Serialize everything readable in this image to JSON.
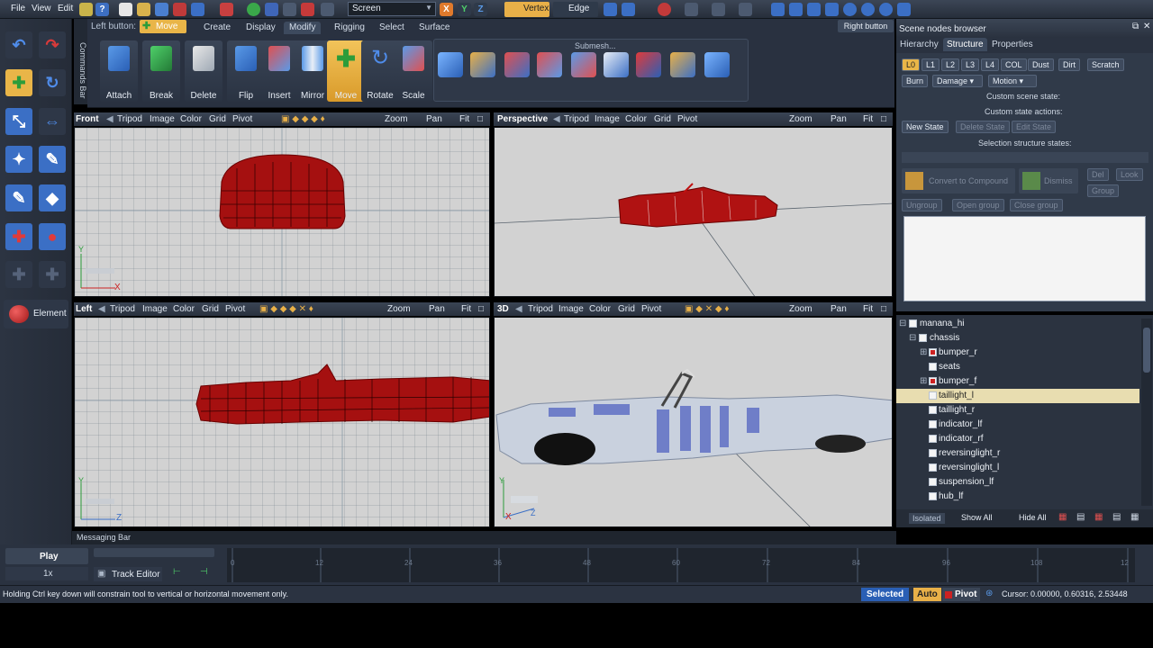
{
  "menu": {
    "file": "File",
    "view": "View",
    "edit": "Edit"
  },
  "toolbar": {
    "coord_mode": "Screen",
    "vertex": "Vertex",
    "edge": "Edge",
    "right_button": "Right button"
  },
  "commands": {
    "left_button_label": "Left button:",
    "left_button_tool": "Move",
    "side_label": "Commands Bar",
    "tabs": [
      "Create",
      "Display",
      "Modify",
      "Rigging",
      "Select",
      "Surface"
    ],
    "active_tab": "Modify",
    "buttons": [
      "Attach",
      "Break",
      "Delete",
      "Flip",
      "Insert",
      "Mirror",
      "Move",
      "Rotate",
      "Scale"
    ],
    "submesh_label": "Submesh..."
  },
  "leftbar": {
    "element_label": "Element"
  },
  "viewports": {
    "tools": [
      "Tripod",
      "Image",
      "Color",
      "Grid",
      "Pivot"
    ],
    "zoom": "Zoom",
    "pan": "Pan",
    "fit": "Fit",
    "front": "Front",
    "perspective": "Perspective",
    "left": "Left",
    "threed": "3D"
  },
  "scene": {
    "title": "Scene nodes browser",
    "tabs": [
      "Hierarchy",
      "Structure",
      "Properties"
    ],
    "active_tab": "Structure",
    "lods": [
      "L0",
      "L1",
      "L2",
      "L3",
      "L4",
      "COL",
      "Dust",
      "Dirt",
      "Scratch"
    ],
    "row2": [
      "Burn",
      "Damage",
      "Motion"
    ],
    "custom_state": "Custom scene state:",
    "custom_actions": "Custom state actions:",
    "new_state": "New State",
    "delete_state": "Delete State",
    "edit_state": "Edit State",
    "selection_states": "Selection structure states:",
    "convert": "Convert to Compound",
    "dismiss": "Dismiss",
    "del": "Del",
    "look": "Look",
    "group": "Group",
    "ungroup": "Ungroup",
    "open_group": "Open group",
    "close_group": "Close group"
  },
  "tree": {
    "root": "manana_hi",
    "items": [
      {
        "label": "chassis",
        "indent": 1,
        "red": false,
        "selected": false
      },
      {
        "label": "bumper_r",
        "indent": 2,
        "red": true,
        "selected": false
      },
      {
        "label": "seats",
        "indent": 2,
        "red": false,
        "selected": false
      },
      {
        "label": "bumper_f",
        "indent": 2,
        "red": true,
        "selected": false
      },
      {
        "label": "taillight_l",
        "indent": 2,
        "red": false,
        "selected": true
      },
      {
        "label": "taillight_r",
        "indent": 2,
        "red": false,
        "selected": false
      },
      {
        "label": "indicator_lf",
        "indent": 2,
        "red": false,
        "selected": false
      },
      {
        "label": "indicator_rf",
        "indent": 2,
        "red": false,
        "selected": false
      },
      {
        "label": "reversinglight_r",
        "indent": 2,
        "red": false,
        "selected": false
      },
      {
        "label": "reversinglight_l",
        "indent": 2,
        "red": false,
        "selected": false
      },
      {
        "label": "suspension_lf",
        "indent": 2,
        "red": false,
        "selected": false
      },
      {
        "label": "hub_lf",
        "indent": 2,
        "red": false,
        "selected": false
      }
    ],
    "isolated": "Isolated",
    "show_all": "Show All",
    "hide_all": "Hide All"
  },
  "timeline": {
    "messaging_bar": "Messaging Bar",
    "play": "Play",
    "speed": "1x",
    "track_editor": "Track Editor",
    "ticks": [
      "0",
      "12",
      "24",
      "36",
      "48",
      "60",
      "72",
      "84",
      "96",
      "108",
      "12"
    ]
  },
  "status": {
    "hint": "Holding Ctrl key down will constrain tool to vertical or horizontal movement only.",
    "selected": "Selected",
    "auto": "Auto",
    "pivot": "Pivot",
    "cursor": "Cursor: 0.00000, 0.60316, 2.53448"
  },
  "axes": {
    "x": "X",
    "y": "Y",
    "z": "Z"
  }
}
